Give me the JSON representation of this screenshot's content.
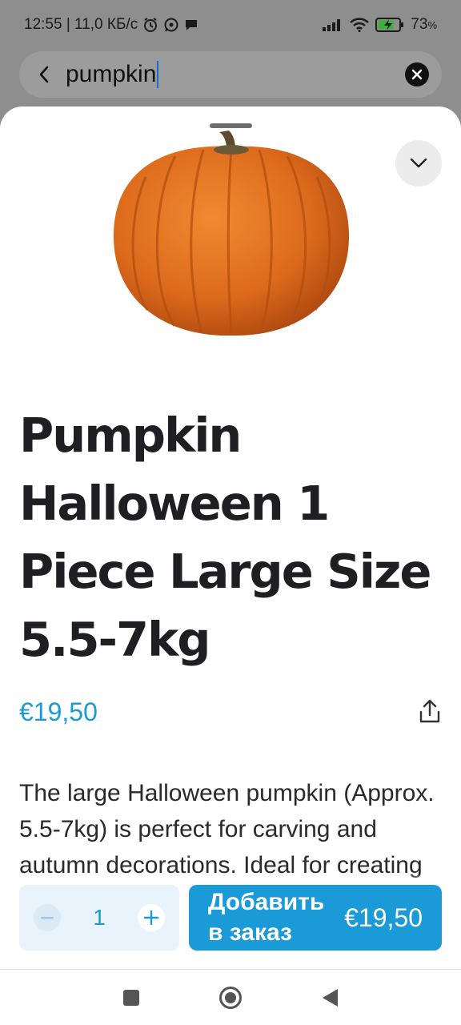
{
  "status_bar": {
    "time_speed": "12:55 | 11,0 КБ/с",
    "battery": "73",
    "battery_unit": "%",
    "icons": [
      "alarm-icon",
      "whatsapp-icon",
      "chat-icon",
      "signal-icon",
      "wifi-icon",
      "battery-charging-icon"
    ]
  },
  "search": {
    "query": "pumpkin",
    "icons": [
      "back-arrow-icon",
      "clear-icon"
    ]
  },
  "product": {
    "title_lines": [
      "Pumpkin",
      "Halloween 1",
      "Piece Large Size",
      "5.5-7kg"
    ],
    "price": "€19,50",
    "description": "The large Halloween pumpkin (Approx. 5.5-7kg) is perfect for carving and autumn decorations. Ideal for creating traditional"
  },
  "cart": {
    "quantity": "1",
    "add_label": "Добавить в заказ",
    "add_price": "€19,50"
  },
  "colors": {
    "accent": "#1a9ad6",
    "title": "#1f1f23",
    "pumpkin": "#e0701e"
  }
}
